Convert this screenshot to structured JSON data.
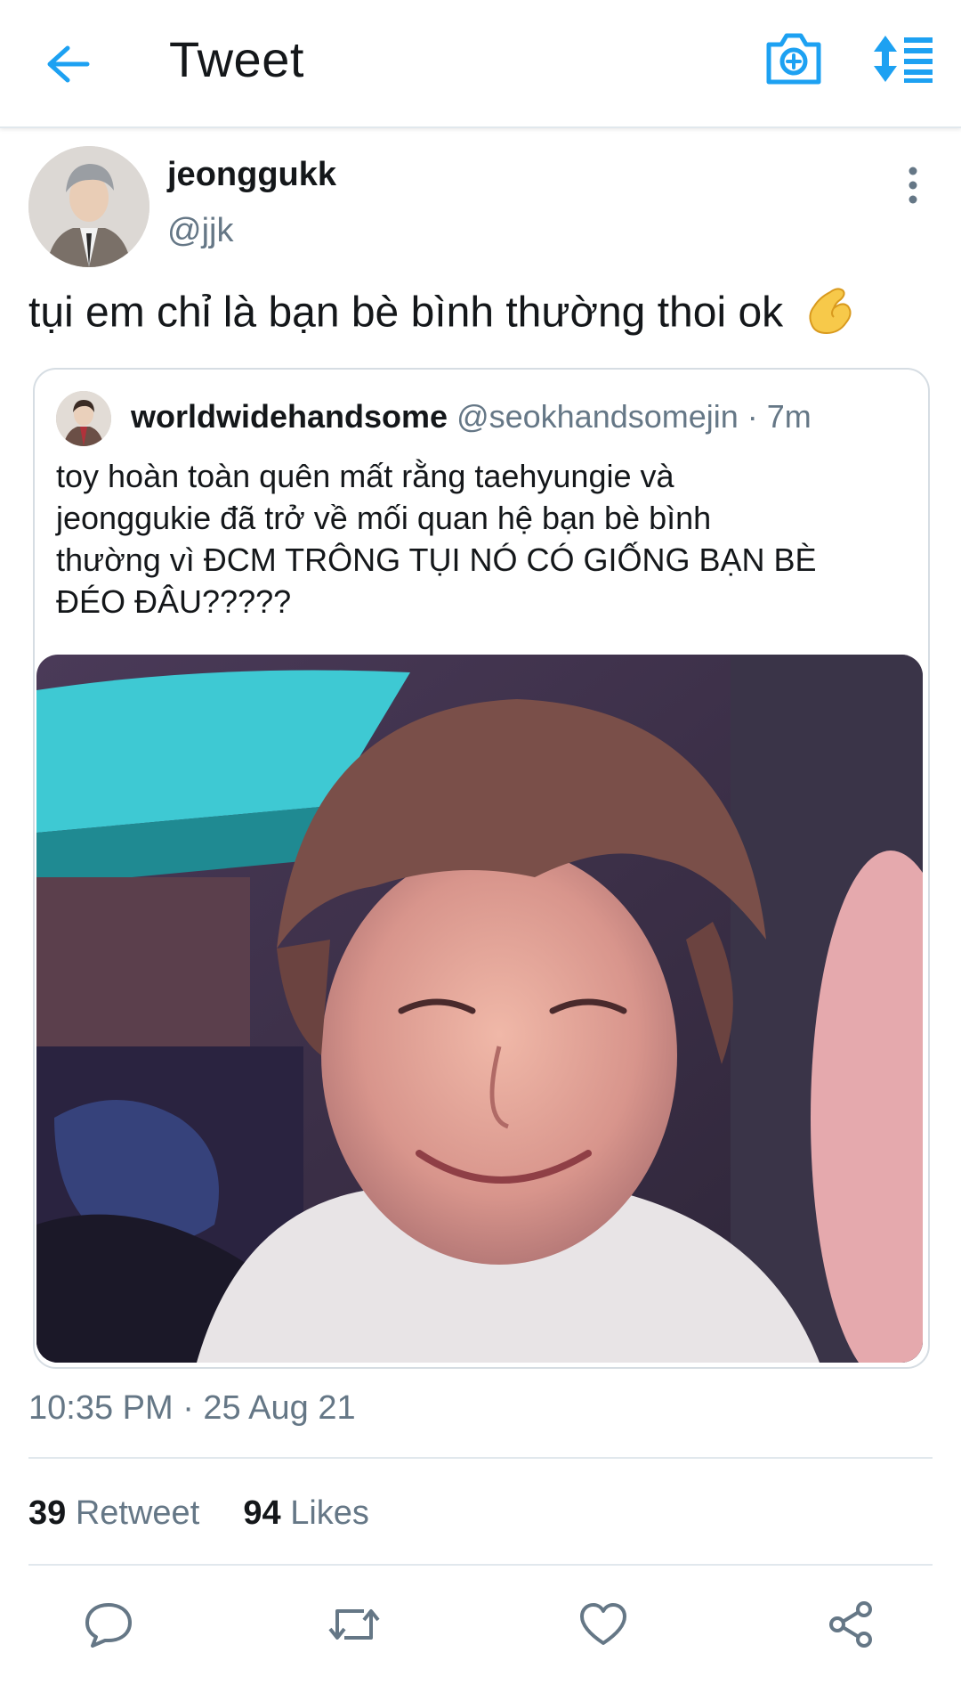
{
  "header": {
    "title": "Tweet",
    "icons": {
      "back": "arrow-left-icon",
      "camera": "camera-plus-icon",
      "sort": "sort-list-icon"
    }
  },
  "tweet": {
    "author_name": "jeonggukk",
    "author_handle": "@jjk",
    "text": "tụi em chỉ là bạn bè bình thường thoi ok",
    "emoji": "pinching-hand-emoji",
    "timestamp": "10:35 PM · 25 Aug 21"
  },
  "quoted": {
    "name": "worldwidehandsome",
    "handle": "@seokhandsomejin",
    "time": " · 7m",
    "lines": [
      "toy hoàn toàn quên mất rằng taehyungie và",
      "jeonggukie đã trở về mối quan hệ bạn bè bình",
      "thường vì ĐCM TRÔNG TỤI NÓ CÓ GIỐNG BẠN BÈ",
      "ĐÉO ĐÂU?????"
    ]
  },
  "stats": {
    "retweets": "39",
    "retweets_label": "Retweet",
    "likes": "94",
    "likes_label": "Likes"
  },
  "actions": [
    "reply-icon",
    "retweet-icon",
    "like-icon",
    "share-icon"
  ],
  "colors": {
    "accent": "#1da1f2",
    "secondary_text": "#657786",
    "divider": "#e1e8ed"
  }
}
